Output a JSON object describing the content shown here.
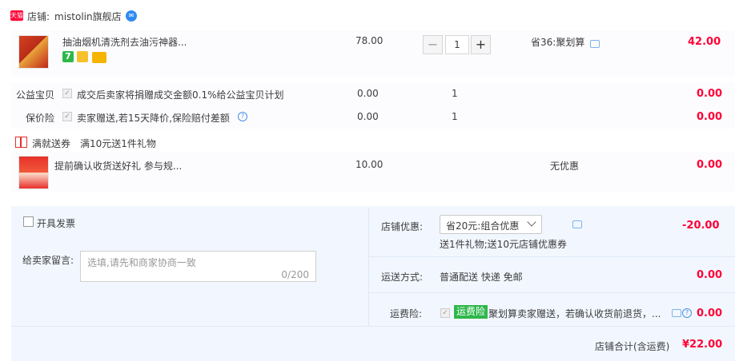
{
  "shop": {
    "label": "店铺:",
    "name": "mistolin旗舰店",
    "tag": "天猫"
  },
  "item1": {
    "title": "抽油烟机清洗剂去油污神器...",
    "price": "78.00",
    "quantity": "1",
    "qty_minus": "−",
    "qty_plus": "+",
    "promo": "省36:聚划算",
    "total": "42.00",
    "badge_7": "7"
  },
  "charity": {
    "label": "公益宝贝",
    "desc": "成交后卖家将捐赠成交金额0.1%给公益宝贝计划",
    "price": "0.00",
    "qty": "1",
    "total": "0.00"
  },
  "insurance": {
    "label": "保价险",
    "desc": "卖家赠送,若15天降价,保险赔付差额",
    "price": "0.00",
    "qty": "1",
    "total": "0.00",
    "help": "?"
  },
  "gift_promo": {
    "label": "满就送券",
    "desc": "满10元送1件礼物"
  },
  "item2": {
    "title": "提前确认收货送好礼 参与规...",
    "price": "10.00",
    "promo": "无优惠",
    "total": "0.00"
  },
  "invoice": {
    "label": "开具发票"
  },
  "message": {
    "label": "给卖家留言:",
    "placeholder": "选填,请先和商家协商一致",
    "count": "0/200"
  },
  "shop_discount": {
    "label": "店铺优惠:",
    "selected": "省20元:组合优惠",
    "sub": "送1件礼物;送10元店铺优惠券",
    "amount": "-20.00"
  },
  "shipping": {
    "label": "运送方式:",
    "value": "普通配送 快递 免邮",
    "amount": "0.00"
  },
  "freight_ins": {
    "label": "运费险:",
    "tag": "运费险",
    "desc": "聚划算卖家赠送，若确认收货前退货，...",
    "amount": "0.00",
    "help": "?"
  },
  "shop_total": {
    "label": "店铺合计(含运费)",
    "amount": "¥22.00"
  },
  "colors": {
    "price_red": "#ff0036",
    "panel_blue": "#f2f7ff",
    "tag_green": "#2db74a"
  }
}
